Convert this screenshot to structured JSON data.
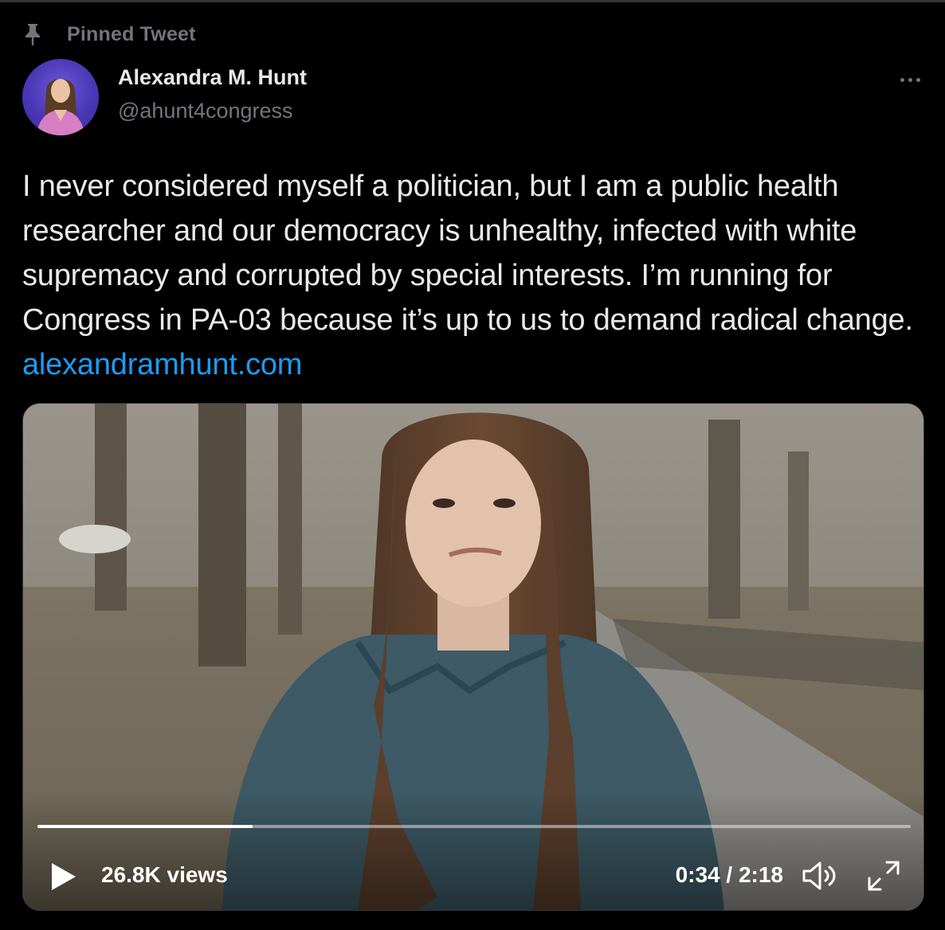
{
  "pinned": {
    "label": "Pinned Tweet",
    "icon": "pin-icon"
  },
  "author": {
    "name": "Alexandra M. Hunt",
    "handle": "@ahunt4congress",
    "avatar_bg": "#4a37b5"
  },
  "tweet": {
    "text": "I never considered myself a politician, but I am a public health researcher and our democracy is unhealthy, infected with white supremacy and corrupted by special interests. I’m running for Congress in PA-03 because it’s up to us to demand radical change.",
    "link": "alexandramhunt.com",
    "link_color": "#1d9bf0"
  },
  "video": {
    "views": "26.8K views",
    "time": "0:34 / 2:18",
    "progress": 0.2464,
    "icons": [
      "play-icon",
      "volume-icon",
      "fullscreen-icon"
    ]
  },
  "colors": {
    "background": "#000000",
    "text_primary": "#e7e9ea",
    "text_secondary": "#71767b",
    "accent": "#1d9bf0"
  }
}
